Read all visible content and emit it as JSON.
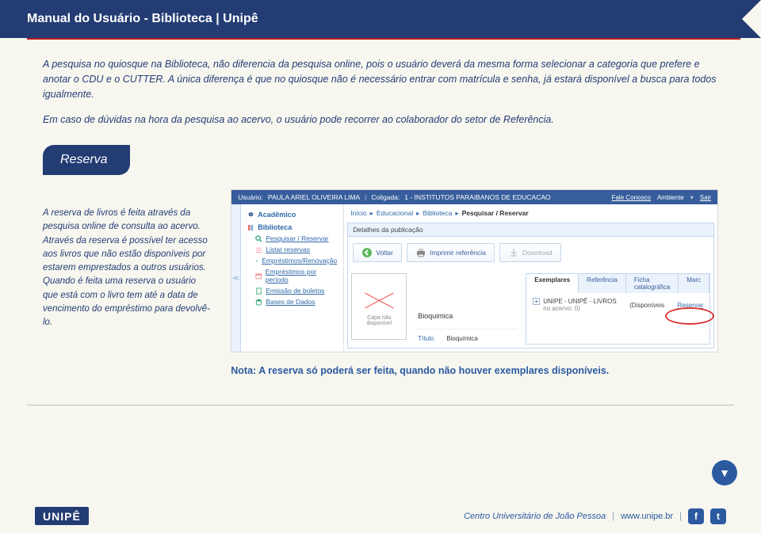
{
  "header": {
    "title": "Manual do Usuário - Biblioteca | Unipê"
  },
  "paragraphs": {
    "p1": "A pesquisa no quiosque na Biblioteca, não diferencia da pesquisa online, pois o usuário deverá da mesma forma selecionar a categoria que prefere e anotar o CDU e o CUTTER. A única diferença é que no quiosque não é necessário entrar com matrícula e senha, já estará disponível a busca para todos igualmente.",
    "p2": "Em caso de dúvidas na hora da pesquisa ao acervo, o usuário pode recorrer ao colaborador do setor de Referência."
  },
  "section": {
    "title": "Reserva",
    "body": "A reserva de livros é feita através da pesquisa online de consulta ao acervo. Através da reserva é possível ter acesso aos livros que não estão disponíveis por estarem emprestados a outros usuários. Quando é feita uma reserva o usuário que está com o livro tem até a data de vencimento do empréstimo para devolvê-lo."
  },
  "screenshot": {
    "topbar": {
      "user_label": "Usuário:",
      "user": "PAULA ARIEL OLIVEIRA LIMA",
      "coligada_label": "Coligada:",
      "coligada": "1 - INSTITUTOS PARAIBANOS DE EDUCACAO",
      "fale": "Fale Conosco",
      "ambiente": "Ambiente",
      "sair": "Sair"
    },
    "sidebar": {
      "academico": "Acadêmico",
      "biblioteca": "Biblioteca",
      "items": [
        "Pesquisar / Reservar",
        "Listar reservas",
        "Empréstimos/Renovação",
        "Empréstimos por período",
        "Emissão de boletos",
        "Bases de Dados"
      ]
    },
    "breadcrumb": {
      "b1": "Início",
      "b2": "Educacional",
      "b3": "Biblioteca",
      "b4": "Pesquisar / Reservar"
    },
    "panel_title": "Detalhes da publicação",
    "buttons": {
      "voltar": "Voltar",
      "imprimir": "Imprimir referência",
      "download": "Download"
    },
    "thumb": {
      "l1": "Capa não",
      "l2": "disponível"
    },
    "fields": {
      "titulo_label": "Título",
      "titulo_value": "Bioquímica"
    },
    "center_value": "Bioquimica",
    "tabs": {
      "t1": "Exemplares",
      "t2": "Referência",
      "t3": "Ficha catalográfica",
      "t4": "Marc"
    },
    "data_row": {
      "loc": "UNIPE - UNIPÊ - LIVROS",
      "acervo": "no acervo: 0)",
      "disp": "(Disponíveis",
      "reservar": "Reservar"
    }
  },
  "note": "Nota: A reserva só poderá ser feita, quando não houver exemplares disponíveis.",
  "footer": {
    "logo": "UNIPÊ",
    "center_name": "Centro Universitário de João Pessoa",
    "url": "www.unipe.br",
    "fb": "f",
    "tw": "t"
  }
}
